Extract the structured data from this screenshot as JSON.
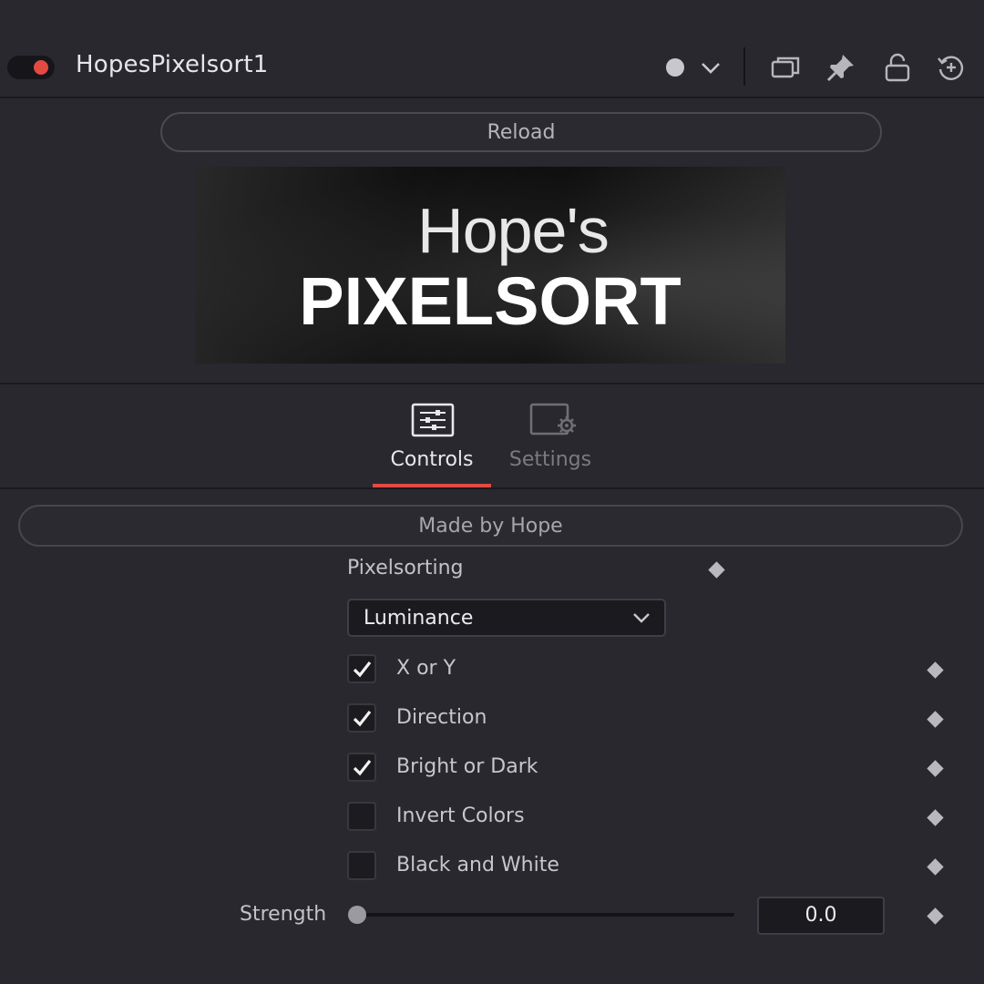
{
  "header": {
    "node_name": "HopesPixelsort1",
    "toggle_color": "#e34a42",
    "icons": [
      "record-dot-icon",
      "chevron-down-icon",
      "duplicate-windows-icon",
      "pin-icon",
      "lock-icon",
      "reset-icon"
    ]
  },
  "reload_label": "Reload",
  "banner": {
    "line1": "Hope's",
    "line2": "PIXELSORT"
  },
  "tabs": [
    {
      "label": "Controls",
      "icon": "sliders-icon",
      "active": true
    },
    {
      "label": "Settings",
      "icon": "settings-gear-icon",
      "active": false
    }
  ],
  "accent_color": "#e34a42",
  "made_by_label": "Made by Hope",
  "pixelsorting": {
    "label": "Pixelsorting",
    "selected": "Luminance"
  },
  "checkboxes": [
    {
      "label": "X or Y",
      "checked": true
    },
    {
      "label": "Direction",
      "checked": true
    },
    {
      "label": "Bright or Dark",
      "checked": true
    },
    {
      "label": "Invert Colors",
      "checked": false
    },
    {
      "label": "Black and White",
      "checked": false
    }
  ],
  "strength": {
    "label": "Strength",
    "value": "0.0",
    "fraction": 0.0
  }
}
